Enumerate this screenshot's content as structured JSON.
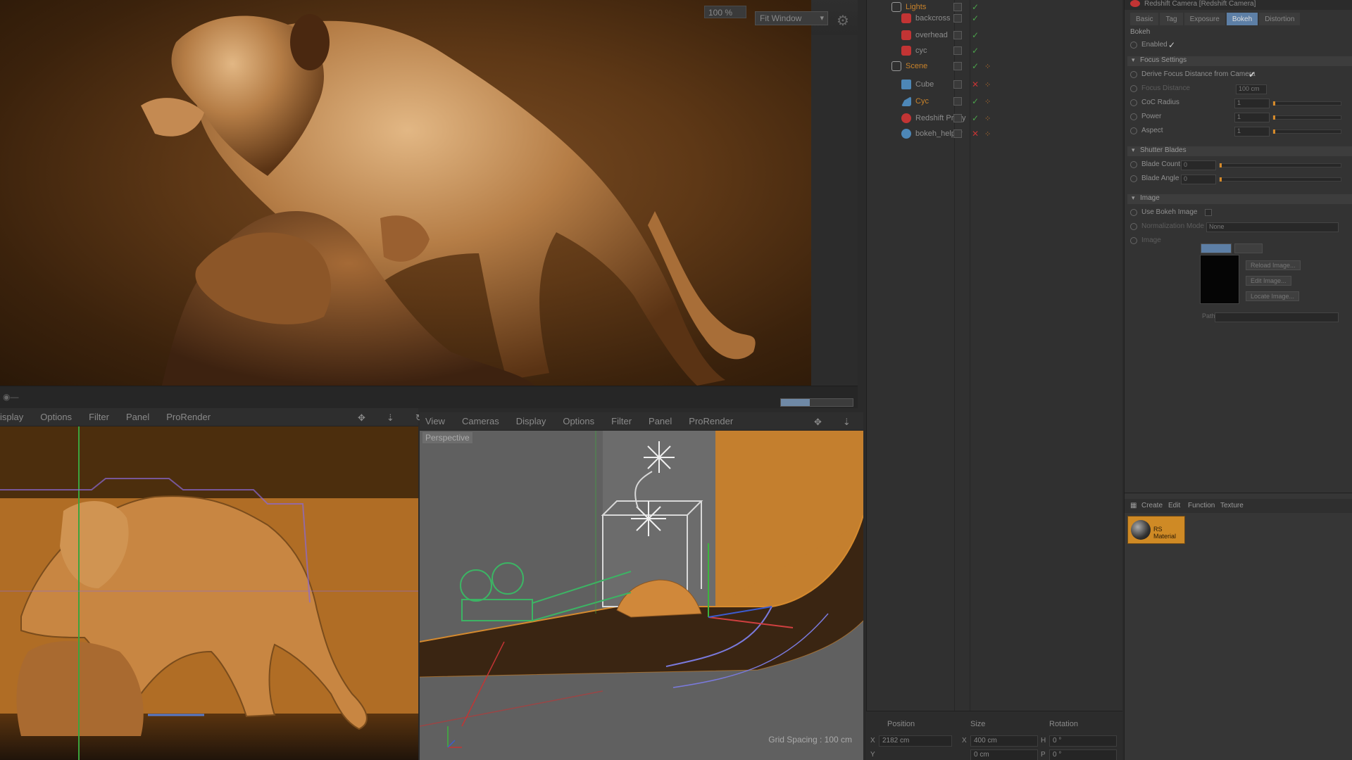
{
  "render_view": {
    "zoom": "100 %",
    "fit_mode": "Fit Window",
    "progress_percent": 40
  },
  "left_viewport": {
    "menu": [
      "isplay",
      "Options",
      "Filter",
      "Panel",
      "ProRender"
    ]
  },
  "right_viewport": {
    "label": "Perspective",
    "menu": [
      "View",
      "Cameras",
      "Display",
      "Options",
      "Filter",
      "Panel",
      "ProRender"
    ],
    "grid_spacing": "Grid Spacing : 100 cm"
  },
  "object_manager": {
    "rows": [
      {
        "name": "Lights",
        "icon": "null-icon"
      },
      {
        "name": "backcross",
        "icon": "light-icon"
      },
      {
        "name": "overhead",
        "icon": "light-icon"
      },
      {
        "name": "cyc",
        "icon": "light-icon"
      },
      {
        "name": "Scene",
        "icon": "null-icon"
      },
      {
        "name": "Cube",
        "icon": "cube-icon"
      },
      {
        "name": "Cyc",
        "icon": "cyc-icon"
      },
      {
        "name": "Redshift Proxy",
        "icon": "proxy-icon"
      },
      {
        "name": "bokeh_helper",
        "icon": "sphere-icon"
      }
    ]
  },
  "coordinates": {
    "headers": [
      "Position",
      "Size",
      "Rotation"
    ],
    "position_x": "2182 cm",
    "position_y": "0 cm",
    "size_x": "400 cm",
    "rotation_h": "0 °",
    "rotation_p": "0 °",
    "axis_x": "X",
    "axis_y": "Y",
    "axis_h": "H",
    "axis_p": "P"
  },
  "attribute_manager": {
    "title": "Redshift Camera [Redshift Camera]",
    "tabs": [
      "Basic",
      "Tag",
      "Exposure",
      "Bokeh",
      "Distortion"
    ],
    "active_tab": "Bokeh",
    "section": "Bokeh",
    "enabled_label": "Enabled",
    "groups": {
      "focus": "Focus Settings",
      "shutter": "Shutter Blades",
      "image": "Image"
    },
    "focus_rows": [
      {
        "label": "Derive Focus Distance from Camera",
        "value": "✔"
      },
      {
        "label": "Focus Distance",
        "value": "100 cm"
      },
      {
        "label": "CoC Radius",
        "value": "1"
      },
      {
        "label": "Power",
        "value": "1"
      },
      {
        "label": "Aspect",
        "value": "1"
      }
    ],
    "shutter_rows": [
      {
        "label": "Blade Count",
        "value": "0"
      },
      {
        "label": "Blade Angle",
        "value": "0"
      }
    ],
    "image_rows": [
      {
        "label": "Use Bokeh Image"
      },
      {
        "label": "Normalization Mode",
        "value": "None"
      },
      {
        "label": "Image"
      }
    ],
    "image_buttons": [
      "Reload Image...",
      "Edit Image...",
      "Locate Image..."
    ],
    "path_label": "Path"
  },
  "material_manager": {
    "menu": [
      "Create",
      "Edit",
      "Function",
      "Texture"
    ],
    "material_name": "RS Material"
  },
  "colors": {
    "accent_orange": "#c8822a",
    "tab_blue": "#5d7fa6",
    "panel": "#333333"
  }
}
